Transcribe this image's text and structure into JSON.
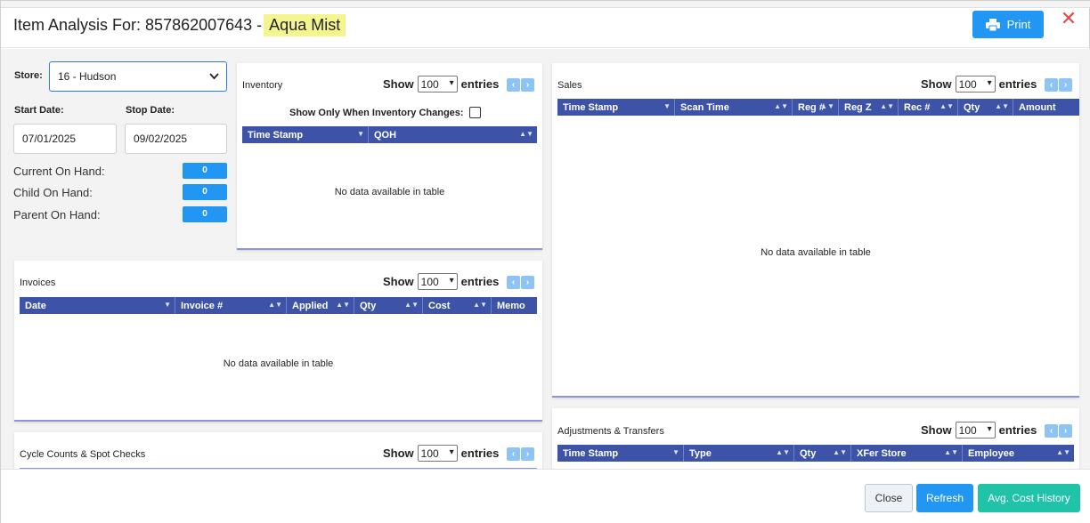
{
  "modal": {
    "title_prefix": "Item Analysis For: 857862007643 -",
    "title_highlight": "Aqua Mist",
    "print_label": "Print",
    "close_glyph": "✕"
  },
  "filters": {
    "store_label": "Store:",
    "store_value": "16 - Hudson",
    "start_label": "Start Date:",
    "start_value": "07/01/2025",
    "stop_label": "Stop Date:",
    "stop_value": "09/02/2025",
    "current_on_hand_label": "Current On Hand:",
    "current_on_hand_value": "0",
    "child_on_hand_label": "Child On Hand:",
    "child_on_hand_value": "0",
    "parent_on_hand_label": "Parent On Hand:",
    "parent_on_hand_value": "0"
  },
  "common": {
    "show_label": "Show",
    "entries_value": "100",
    "entries_label": "entries",
    "no_data": "No data available in table"
  },
  "inventory": {
    "title": "Inventory",
    "only_changes_label": "Show Only When Inventory Changes:",
    "columns": [
      "Time Stamp",
      "QOH"
    ]
  },
  "sales": {
    "title": "Sales",
    "columns": [
      "Time Stamp",
      "Scan Time",
      "Reg #",
      "Reg Z",
      "Rec #",
      "Qty",
      "Amount"
    ]
  },
  "invoices": {
    "title": "Invoices",
    "columns": [
      "Date",
      "Invoice #",
      "Applied",
      "Qty",
      "Cost",
      "Memo"
    ]
  },
  "cycle_counts": {
    "title": "Cycle Counts & Spot Checks"
  },
  "adjustments": {
    "title": "Adjustments & Transfers",
    "columns": [
      "Time Stamp",
      "Type",
      "Qty",
      "XFer Store",
      "Employee"
    ]
  },
  "footer": {
    "close_label": "Close",
    "refresh_label": "Refresh",
    "avg_cost_label": "Avg. Cost History"
  },
  "colors": {
    "primary": "#2196f3",
    "table_header": "#3d53a8",
    "teal": "#20c2a8",
    "highlight": "#f4f58f",
    "close_x": "#e34b4b"
  }
}
